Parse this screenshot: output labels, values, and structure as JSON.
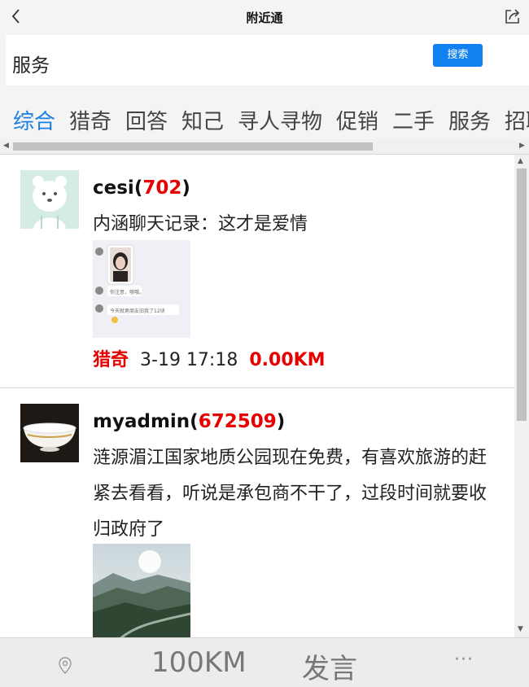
{
  "header": {
    "title": "附近通",
    "back_icon": "chevron-left-icon",
    "share_icon": "share-icon"
  },
  "search": {
    "value": "服务",
    "button_label": "搜索",
    "button_color": "#1081f0"
  },
  "tabs": [
    {
      "label": "综合",
      "active": true
    },
    {
      "label": "猎奇",
      "active": false
    },
    {
      "label": "回答",
      "active": false
    },
    {
      "label": "知己",
      "active": false
    },
    {
      "label": "寻人寻物",
      "active": false
    },
    {
      "label": "促销",
      "active": false
    },
    {
      "label": "二手",
      "active": false
    },
    {
      "label": "服务",
      "active": false
    },
    {
      "label": "招聘",
      "active": false
    }
  ],
  "posts": [
    {
      "username": "cesi",
      "open": "(",
      "score": "702",
      "close": ")",
      "text": "内涵聊天记录：这才是爱情",
      "category": "猎奇",
      "time": "3-19 17:18",
      "distance": "0.00KM",
      "chat_preview": {
        "line1": "你注意，够哦。",
        "line2": "今天就男朋友旧我了12块"
      }
    },
    {
      "username": "myadmin",
      "open": "(",
      "score": "672509",
      "close": ")",
      "text": "涟源湄江国家地质公园现在免费，有喜欢旅游的赶紧去看看，听说是承包商不干了，过段时间就要收归政府了"
    }
  ],
  "bottom_bar": {
    "location_icon": "location-pin-icon",
    "distance_label": "100KM",
    "speak_label": "发言",
    "more_label": "···"
  },
  "colors": {
    "accent": "#1a7fe0",
    "highlight": "#e60000"
  }
}
